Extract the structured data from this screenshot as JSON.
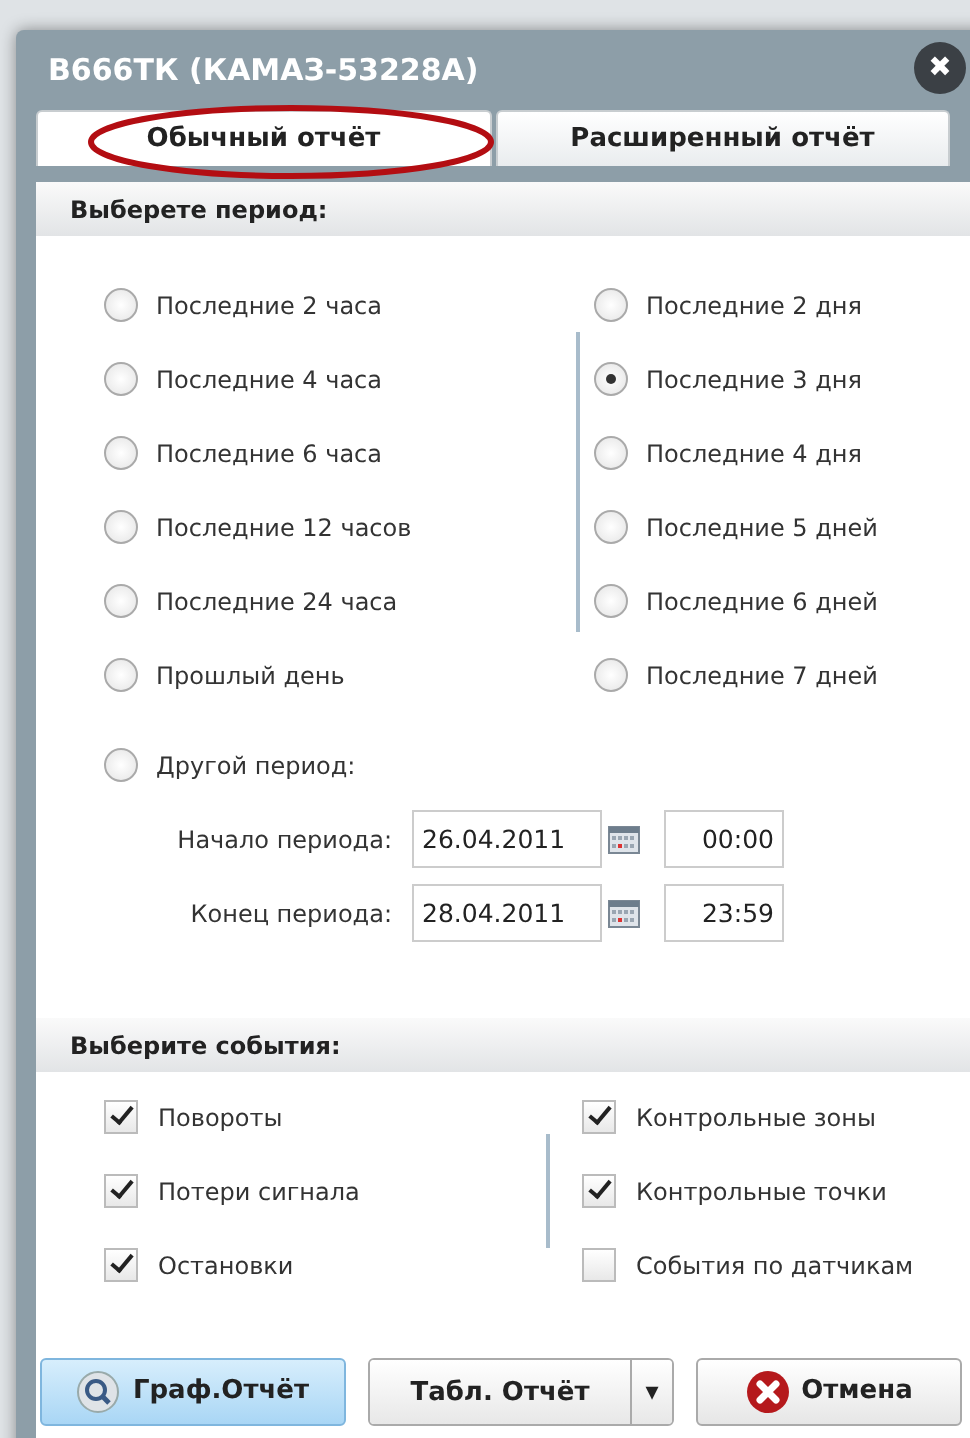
{
  "window": {
    "title": "В666ТК (КАМАЗ-53228А)",
    "close_label": "✖"
  },
  "tabs": [
    {
      "label": "Обычный отчёт",
      "selected": true
    },
    {
      "label": "Расширенный отчёт",
      "selected": false
    }
  ],
  "period": {
    "heading": "Выберете период:",
    "options": [
      {
        "label": "Последние 2 часа",
        "selected": false
      },
      {
        "label": "Последние 4 часа",
        "selected": false
      },
      {
        "label": "Последние 6 часа",
        "selected": false
      },
      {
        "label": "Последние 12 часов",
        "selected": false
      },
      {
        "label": "Последние 24 часа",
        "selected": false
      },
      {
        "label": "Прошлый день",
        "selected": false
      },
      {
        "label": "Последние 2 дня",
        "selected": false
      },
      {
        "label": "Последние 3 дня",
        "selected": true
      },
      {
        "label": "Последние 4 дня",
        "selected": false
      },
      {
        "label": "Последние 5 дней",
        "selected": false
      },
      {
        "label": "Последние 6 дней",
        "selected": false
      },
      {
        "label": "Последние 7 дней",
        "selected": false
      }
    ],
    "custom": {
      "label": "Другой период:",
      "selected": false
    },
    "ranges": [
      {
        "label": "Начало периода:",
        "date": "26.04.2011",
        "time": "00:00"
      },
      {
        "label": "Конец периода:",
        "date": "28.04.2011",
        "time": "23:59"
      }
    ]
  },
  "events": {
    "heading": "Выберите события:",
    "items": [
      {
        "label": "Повороты",
        "checked": true
      },
      {
        "label": "Потери сигнала",
        "checked": true
      },
      {
        "label": "Остановки",
        "checked": true
      },
      {
        "label": "Контрольные зоны",
        "checked": true
      },
      {
        "label": "Контрольные точки",
        "checked": true
      },
      {
        "label": "События по датчикам",
        "checked": false
      }
    ]
  },
  "buttons": [
    {
      "kind": "graph",
      "label": "Граф.Отчёт"
    },
    {
      "kind": "split",
      "label": "Табл. Отчёт",
      "caret": "▾"
    },
    {
      "kind": "cancel",
      "label": "Отмена"
    }
  ]
}
